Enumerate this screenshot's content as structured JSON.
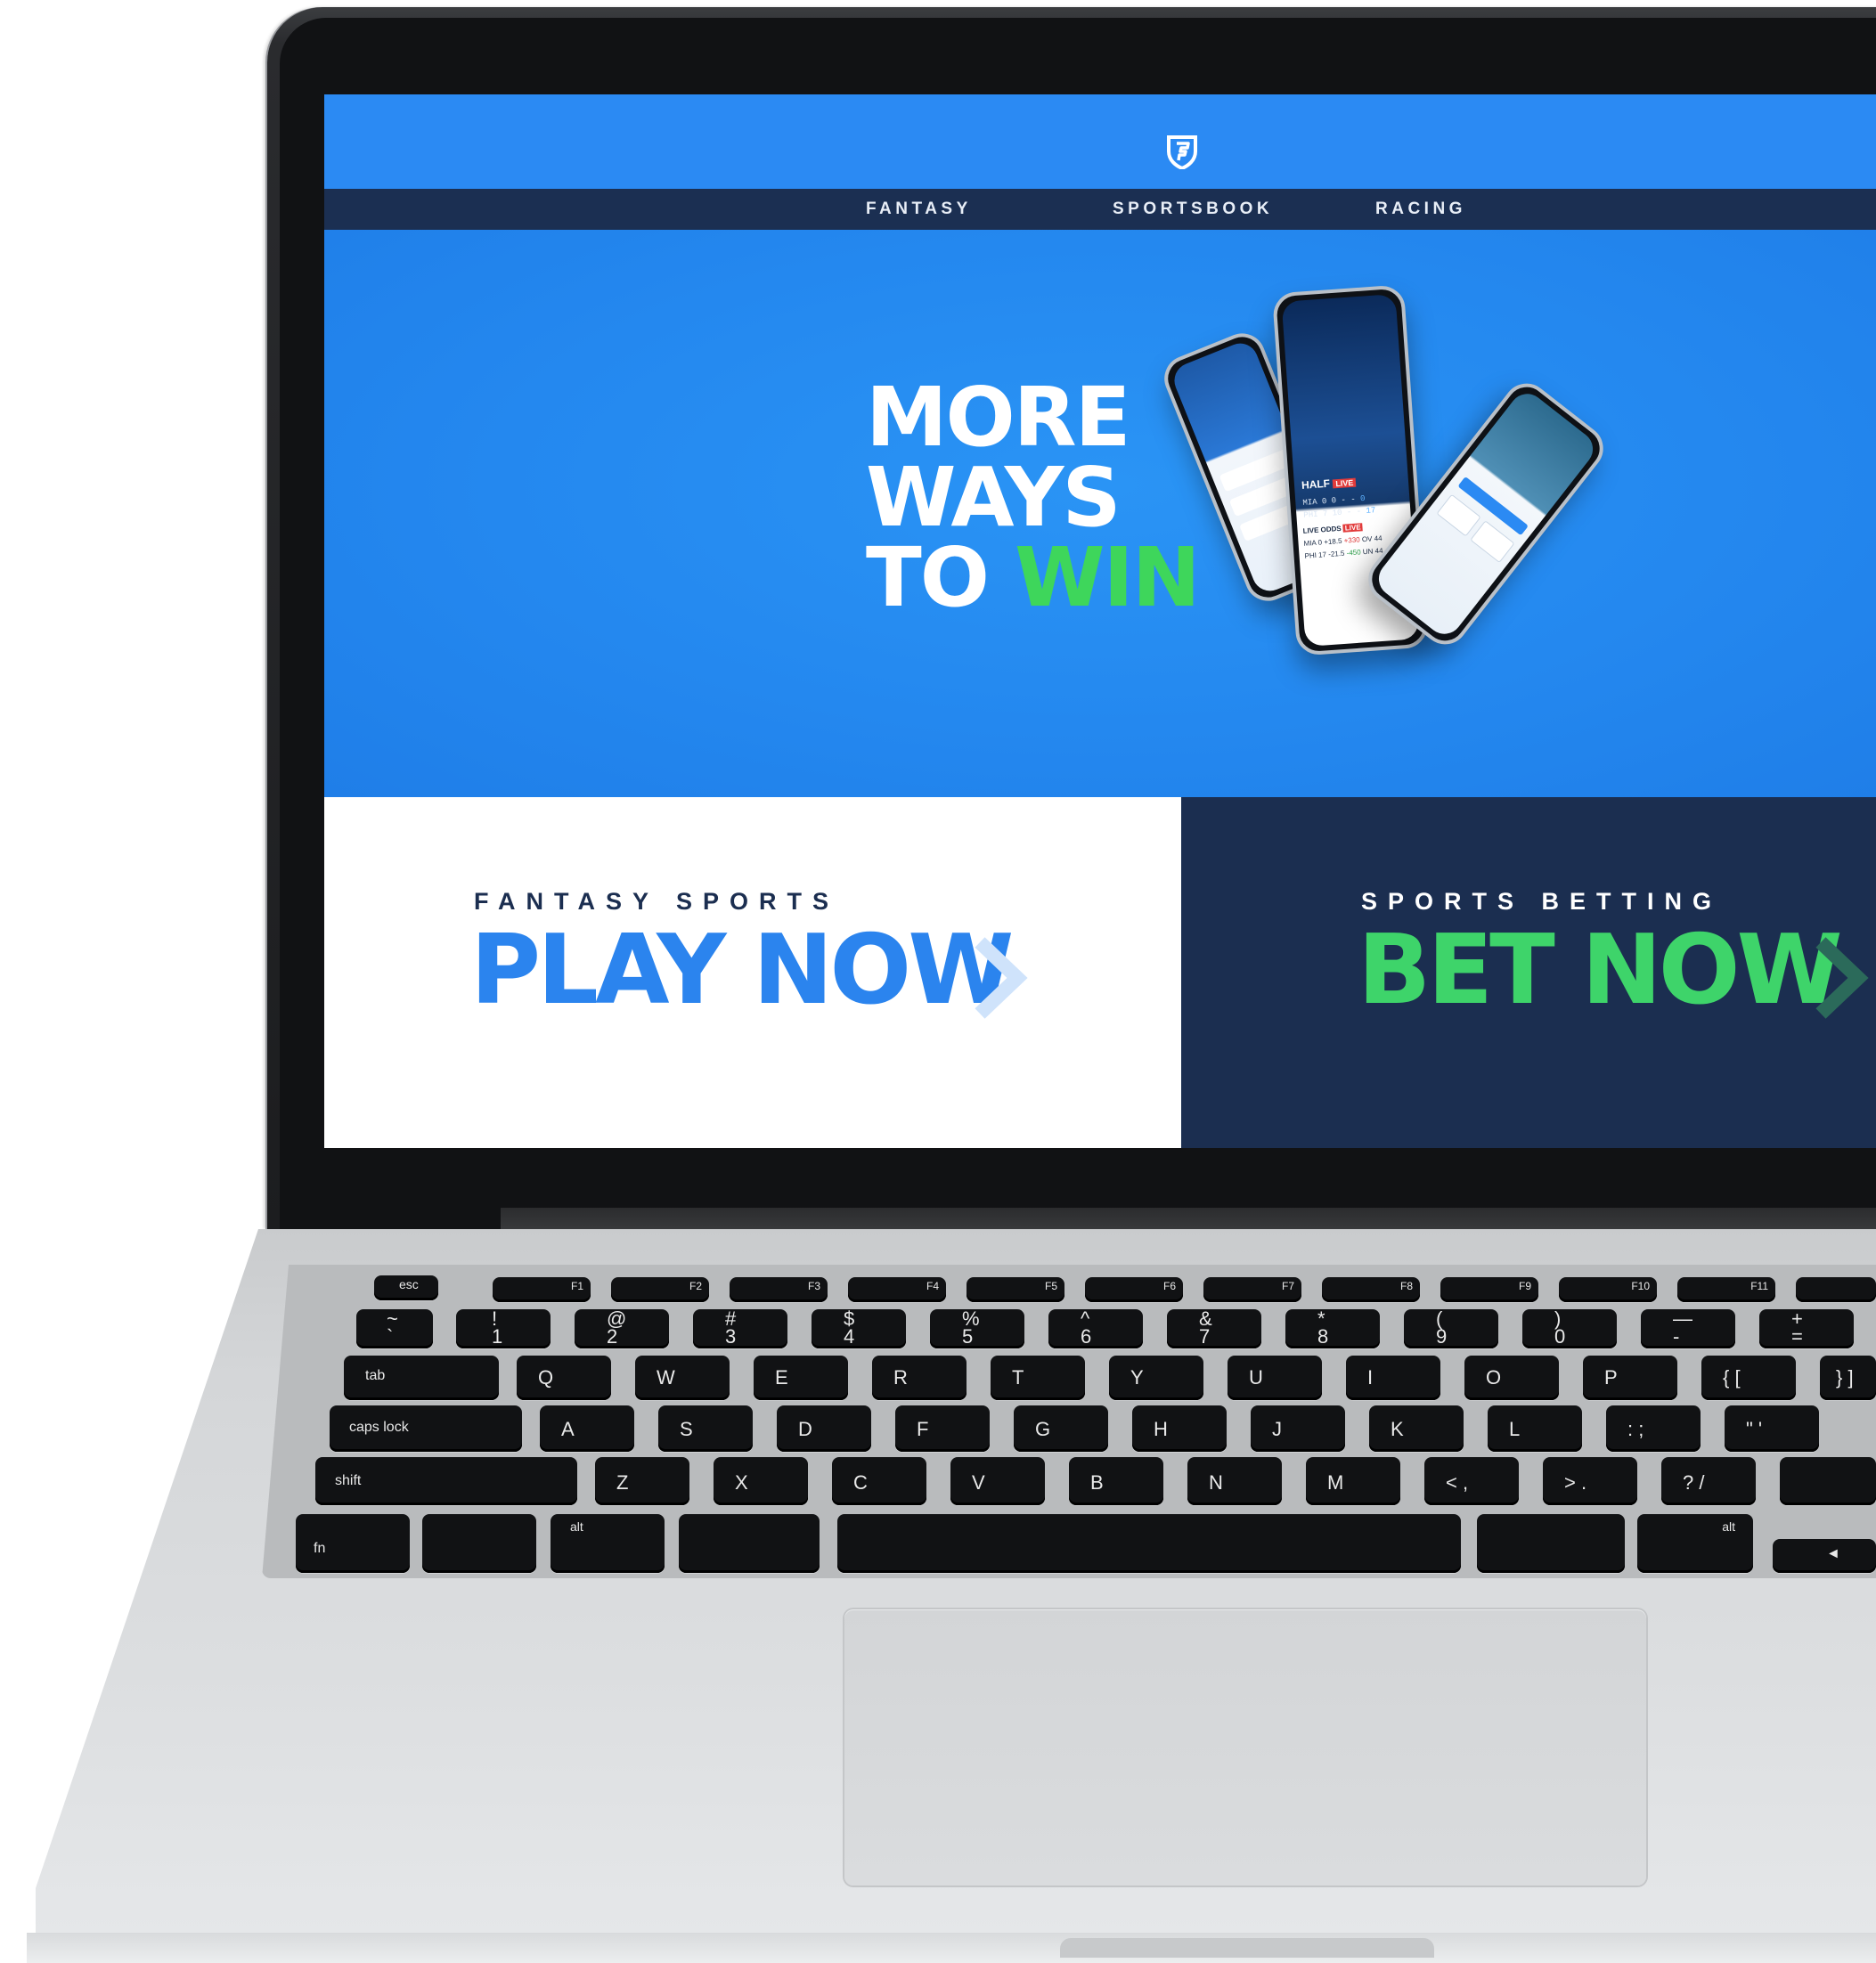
{
  "site": {
    "brand_logo": "fanduel-shield-logo",
    "nav": [
      {
        "label": "FANTASY"
      },
      {
        "label": "SPORTSBOOK"
      },
      {
        "label": "RACING"
      }
    ],
    "hero": {
      "line1": "MORE",
      "line2": "WAYS",
      "line3_a": "TO",
      "line3_b": "WIN",
      "phone_center": {
        "period": "HALF",
        "live": "LIVE",
        "rows": [
          {
            "team": "MIA",
            "q": "0 0 - -",
            "score": "0"
          },
          {
            "team": "PHI",
            "q": "7 10 - -",
            "score": "17"
          }
        ],
        "odds_title": "LIVE ODDS",
        "odds_live": "LIVE",
        "odds_rows": [
          {
            "team": "MIA",
            "score": "0",
            "spread": "+18.5",
            "ml": "+330",
            "total": "OV 44"
          },
          {
            "team": "PHI",
            "score": "17",
            "spread": "-21.5",
            "ml": "-450",
            "total": "UN 44"
          }
        ]
      }
    },
    "fantasy_panel": {
      "kicker": "FANTASY SPORTS",
      "cta": "PLAY NOW"
    },
    "bet_panel": {
      "kicker": "SPORTS BETTING",
      "cta": "BET NOW"
    }
  },
  "keyboard": {
    "fn_row": [
      "esc",
      "F1",
      "F2",
      "F3",
      "F4",
      "F5",
      "F6",
      "F7",
      "F8",
      "F9",
      "F10",
      "F11"
    ],
    "num_row": [
      {
        "top": "~",
        "bottom": "`"
      },
      {
        "top": "!",
        "bottom": "1"
      },
      {
        "top": "@",
        "bottom": "2"
      },
      {
        "top": "#",
        "bottom": "3"
      },
      {
        "top": "$",
        "bottom": "4"
      },
      {
        "top": "%",
        "bottom": "5"
      },
      {
        "top": "^",
        "bottom": "6"
      },
      {
        "top": "&",
        "bottom": "7"
      },
      {
        "top": "*",
        "bottom": "8"
      },
      {
        "top": "(",
        "bottom": "9"
      },
      {
        "top": ")",
        "bottom": "0"
      },
      {
        "top": "—",
        "bottom": "-"
      },
      {
        "top": "+",
        "bottom": "="
      }
    ],
    "q_row": [
      "tab",
      "Q",
      "W",
      "E",
      "R",
      "T",
      "Y",
      "U",
      "I",
      "O",
      "P",
      "{ [",
      "} ]"
    ],
    "a_row": [
      "caps lock",
      "A",
      "S",
      "D",
      "F",
      "G",
      "H",
      "J",
      "K",
      "L",
      ": ;",
      "\" '"
    ],
    "z_row": [
      "shift",
      "Z",
      "X",
      "C",
      "V",
      "B",
      "N",
      "M",
      "< ,",
      "> .",
      "? /",
      ""
    ],
    "bottom_row": [
      "fn",
      "",
      "alt",
      "",
      "",
      "alt",
      "◄"
    ]
  }
}
